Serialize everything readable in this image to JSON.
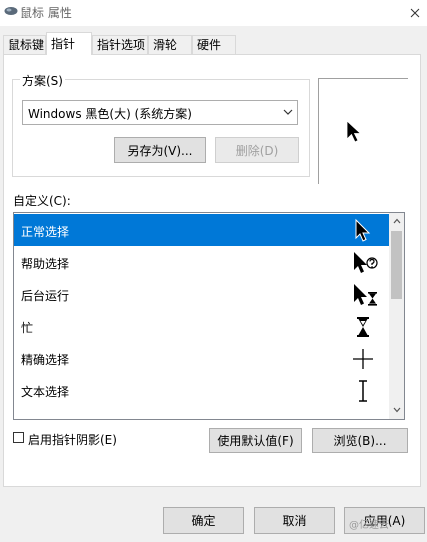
{
  "window": {
    "title": "鼠标 属性"
  },
  "tabs": [
    {
      "label": "鼠标键",
      "active": false
    },
    {
      "label": "指针",
      "active": true
    },
    {
      "label": "指针选项",
      "active": false
    },
    {
      "label": "滑轮",
      "active": false
    },
    {
      "label": "硬件",
      "active": false
    }
  ],
  "scheme": {
    "label": "方案(S)",
    "selected": "Windows 黑色(大) (系统方案)",
    "save_as_label": "另存为(V)...",
    "delete_label": "删除(D)"
  },
  "custom": {
    "label": "自定义(C):",
    "items": [
      {
        "label": "正常选择",
        "icon": "arrow-cursor-icon",
        "selected": true
      },
      {
        "label": "帮助选择",
        "icon": "help-cursor-icon",
        "selected": false
      },
      {
        "label": "后台运行",
        "icon": "working-in-background-cursor-icon",
        "selected": false
      },
      {
        "label": "忙",
        "icon": "busy-hourglass-icon",
        "selected": false
      },
      {
        "label": "精确选择",
        "icon": "precision-crosshair-icon",
        "selected": false
      },
      {
        "label": "文本选择",
        "icon": "text-ibeam-icon",
        "selected": false
      }
    ]
  },
  "options": {
    "shadow_label": "启用指针阴影(E)",
    "shadow_checked": false,
    "use_default_label": "使用默认值(F)",
    "browse_label": "浏览(B)..."
  },
  "footer": {
    "ok_label": "确定",
    "cancel_label": "取消",
    "apply_label": "应用(A)"
  },
  "watermark": "@亿速云",
  "colors": {
    "selection": "#0078d7",
    "window_bg": "#f0f0f0",
    "panel_bg": "#ffffff"
  }
}
